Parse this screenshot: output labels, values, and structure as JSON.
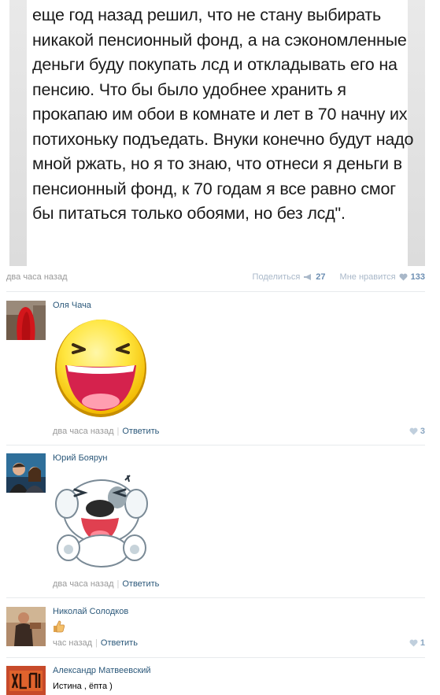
{
  "post": {
    "text": "еще год назад решил, что не стану выбирать никакой пенсионный фонд, а на сэкономленные деньги буду покупать лсд и откладывать его на пенсию. Что бы было удобнее хранить я прокапаю им обои в комнате и лет в 70 начну их потихоньку подъедать. Внуки конечно будут надо мной ржать, но я то знаю, что отнеси я деньги в пенсионный фонд, к 70 годам я все равно смог бы питаться только обоями, но без лсд\".",
    "time": "два часа назад",
    "share_label": "Поделиться",
    "share_count": "27",
    "like_label": "Мне нравится",
    "like_count": "133"
  },
  "comments": [
    {
      "author": "Оля Чача",
      "time": "два часа назад",
      "reply": "Ответить",
      "likes": "3",
      "sticker": "laughing-smiley"
    },
    {
      "author": "Юрий Боярун",
      "time": "два часа назад",
      "reply": "Ответить",
      "sticker": "laughing-dog"
    },
    {
      "author": "Николай Солодков",
      "time": "час назад",
      "reply": "Ответить",
      "likes": "1",
      "sticker": "thumbs-up"
    },
    {
      "author": "Александр Матвеевский",
      "text": "Истина , ёпта )"
    }
  ],
  "colors": {
    "link": "#2b587a",
    "muted": "#999999",
    "like": "#6d8fb3"
  }
}
